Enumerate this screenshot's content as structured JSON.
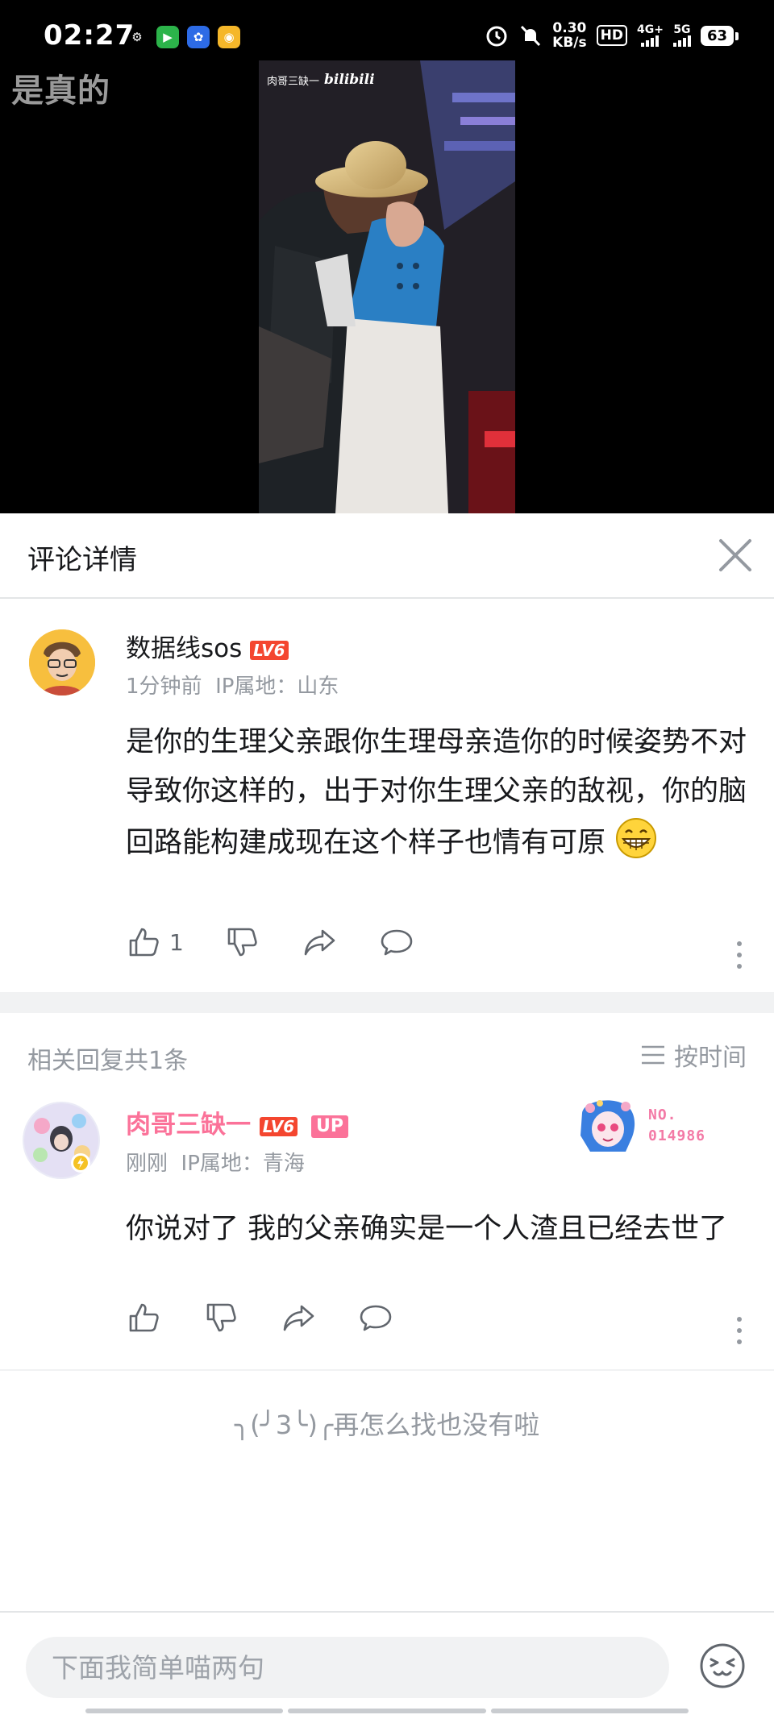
{
  "status_bar": {
    "time": "02:27",
    "net_speed_value": "0.30",
    "net_speed_unit": "KB/s",
    "hd_label": "HD",
    "sim1_network": "4G+",
    "sim2_network": "5G",
    "battery": "63"
  },
  "video": {
    "overlay_caption": "是真的",
    "watermark_author": "肉哥三缺一",
    "watermark_brand": "bilibili"
  },
  "panel": {
    "title": "评论详情"
  },
  "main_comment": {
    "username": "数据线sos",
    "level": "LV6",
    "time": "1分钟前",
    "ip": "IP属地：山东",
    "text": "是你的生理父亲跟你生理母亲造你的时候姿势不对导致你这样的，出于对你生理父亲的敌视，你的脑回路能构建成现在这个样子也情有可原",
    "emoji_icon": "grin-emoji-icon",
    "like_count": "1"
  },
  "replies": {
    "header": "相关回复共1条",
    "sort_label": "按时间",
    "items": [
      {
        "username": "肉哥三缺一",
        "level": "LV6",
        "up_tag": "UP",
        "time": "刚刚",
        "ip": "IP属地：青海",
        "text": "你说对了 我的父亲确实是一个人渣且已经去世了",
        "fan_badge_no": "NO.",
        "fan_badge_number": "014986"
      }
    ],
    "end_note": "╮(╯3╰)╭再怎么找也没有啦"
  },
  "composer": {
    "placeholder": "下面我简单喵两句"
  },
  "colors": {
    "accent_pink": "#fb7299",
    "level_red": "#f4462f",
    "text_primary": "#18191c",
    "text_secondary": "#9499a0",
    "icon_gray": "#61666d"
  }
}
